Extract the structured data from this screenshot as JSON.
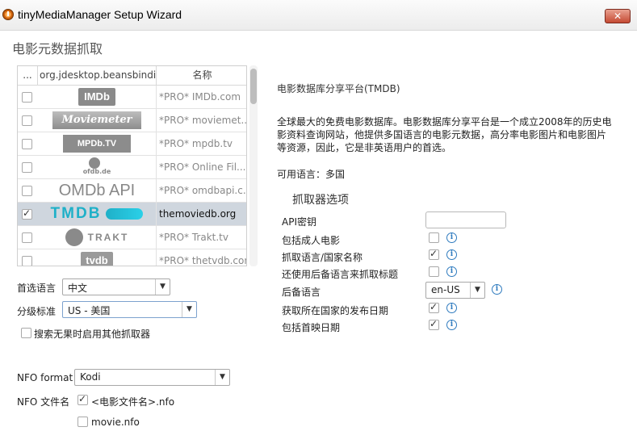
{
  "window": {
    "title": "tinyMediaManager Setup Wizard",
    "close_label": "✕"
  },
  "page_title": "电影元数据抓取",
  "scraper_table": {
    "headers": [
      "...",
      "org.jdesktop.beansbindi...",
      "名称"
    ],
    "rows": [
      {
        "checked": false,
        "logo": "IMDb",
        "name": "*PRO* IMDb.com",
        "selected": false
      },
      {
        "checked": false,
        "logo": "Moviemeter",
        "name": "*PRO* moviemet...",
        "selected": false
      },
      {
        "checked": false,
        "logo": "MPDb.TV",
        "name": "*PRO* mpdb.tv",
        "selected": false
      },
      {
        "checked": false,
        "logo": "ofdb.de",
        "name": "*PRO* Online Fil...",
        "selected": false
      },
      {
        "checked": false,
        "logo": "OMDb API",
        "name": "*PRO* omdbapi.c...",
        "selected": false
      },
      {
        "checked": true,
        "logo": "TMDB",
        "name": "themoviedb.org",
        "selected": true
      },
      {
        "checked": false,
        "logo": "TRAKT",
        "name": "*PRO* Trakt.tv",
        "selected": false
      },
      {
        "checked": false,
        "logo": "tvdb",
        "name": "*PRO* thetvdb.com",
        "selected": false
      }
    ]
  },
  "left_form": {
    "preferred_language_label": "首选语言",
    "preferred_language_value": "中文",
    "certification_label": "分级标准",
    "certification_value": "US - 美国",
    "fallback_search_label": "搜索无果时启用其他抓取器",
    "fallback_search_checked": false,
    "nfo_format_label": "NFO format",
    "nfo_format_value": "Kodi",
    "nfo_filename_label": "NFO 文件名",
    "nfo_option1_label": "<电影文件名>.nfo",
    "nfo_option1_checked": true,
    "nfo_option2_label": "movie.nfo",
    "nfo_option2_checked": false
  },
  "right_panel": {
    "title": "电影数据库分享平台(TMDB)",
    "description": "全球最大的免费电影数据库。电影数据库分享平台是一个成立2008年的历史电影资料查询网站，他提供多国语言的电影元数据，高分率电影图片和电影图片等资源，因此，它是非英语用户的首选。",
    "languages": "可用语言：多国",
    "options_title": "抓取器选项",
    "api_key_label": "API密钥",
    "api_key_value": "",
    "options": [
      {
        "label": "包括成人电影",
        "checked": false
      },
      {
        "label": "抓取语言/国家名称",
        "checked": true
      },
      {
        "label": "还使用后备语言来抓取标题",
        "checked": false
      }
    ],
    "fallback_language_label": "后备语言",
    "fallback_language_value": "en-US",
    "options2": [
      {
        "label": "获取所在国家的发布日期",
        "checked": true
      },
      {
        "label": "包括首映日期",
        "checked": true
      }
    ]
  },
  "icons": {
    "info": "info-icon",
    "app": "tinymediamanager-app-icon",
    "close": "close-icon",
    "dropdown": "chevron-down-icon"
  },
  "colors": {
    "selected_row": "#cfd6de",
    "info_blue": "#2f7bbf",
    "tmdb_teal": "#1fb0c8",
    "close_red": "#c54a33"
  }
}
